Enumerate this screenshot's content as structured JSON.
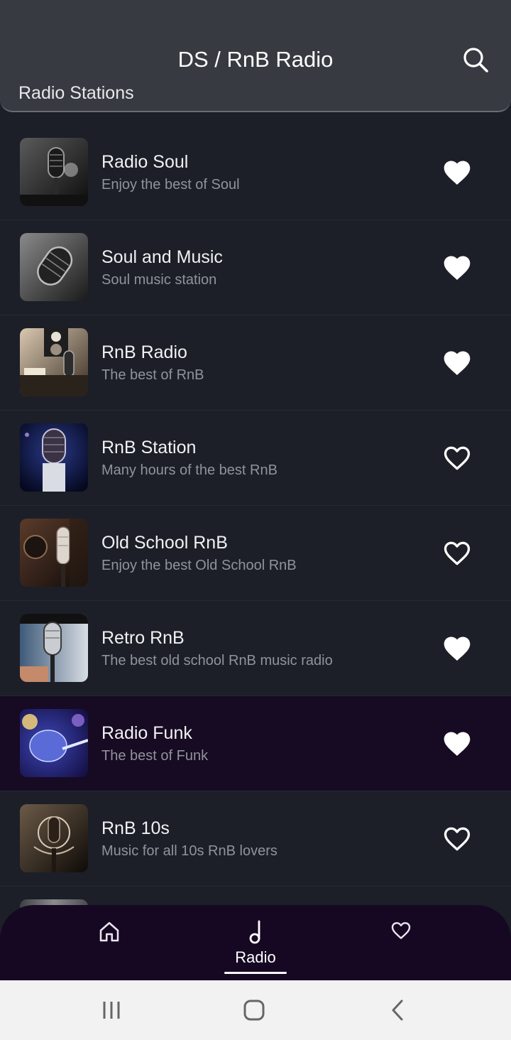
{
  "header": {
    "title": "DS / RnB Radio",
    "section_title": "Radio Stations",
    "search_icon": "search-icon"
  },
  "stations": [
    {
      "name": "Radio Soul",
      "description": "Enjoy the best of Soul",
      "favorite": true,
      "thumb": "studio-microphone"
    },
    {
      "name": "Soul and Music",
      "description": "Soul music station",
      "favorite": true,
      "thumb": "condenser-microphone"
    },
    {
      "name": "RnB Radio",
      "description": "The best of RnB",
      "favorite": true,
      "thumb": "studio-monitor"
    },
    {
      "name": "RnB Station",
      "description": "Many hours of the best RnB",
      "favorite": false,
      "thumb": "usb-microphone"
    },
    {
      "name": "Old School RnB",
      "description": "Enjoy the best Old School RnB",
      "favorite": false,
      "thumb": "vintage-microphone"
    },
    {
      "name": "Retro RnB",
      "description": "The best old school RnB music radio",
      "favorite": true,
      "thumb": "retro-microphone"
    },
    {
      "name": "Radio Funk",
      "description": "The best of Funk",
      "favorite": true,
      "active": true,
      "thumb": "stage-microphone"
    },
    {
      "name": "RnB 10s",
      "description": "Music for all 10s RnB lovers",
      "favorite": false,
      "thumb": "pop-filter-microphone"
    }
  ],
  "bottom_nav": {
    "items": [
      {
        "icon": "home-icon",
        "label": ""
      },
      {
        "icon": "music-note-icon",
        "label": "Radio",
        "selected": true
      },
      {
        "icon": "heart-outline-icon",
        "label": ""
      }
    ]
  },
  "system_nav": {
    "items": [
      "recent-apps-icon",
      "home-button-icon",
      "back-icon"
    ]
  },
  "colors": {
    "background": "#1c1f27",
    "header": "#373a41",
    "active_row": "#170a23",
    "bottom_nav": "#160823",
    "subtitle_text": "#8f939b"
  }
}
